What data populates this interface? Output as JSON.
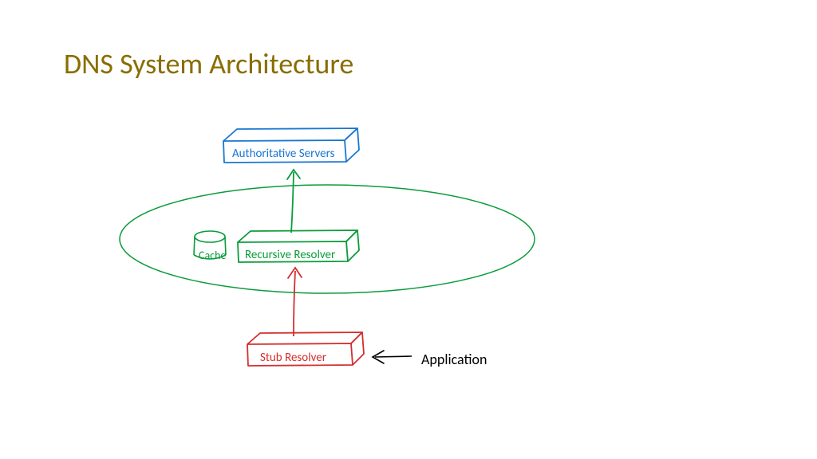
{
  "title": "DNS System Architecture",
  "nodes": {
    "authoritative": "Authoritative Servers",
    "cache": "Cache",
    "recursive": "Recursive Resolver",
    "stub": "Stub Resolver",
    "application": "Application"
  },
  "colors": {
    "title": "#8a6d00",
    "blue": "#1976d2",
    "green": "#0a9c3a",
    "red": "#d32f2f",
    "black": "#000000"
  }
}
